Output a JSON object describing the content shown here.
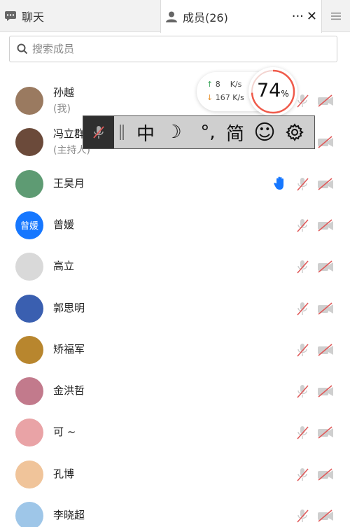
{
  "tabs": {
    "chat_label": "聊天",
    "members_label": "成员(26)",
    "more": "···",
    "close": "✕"
  },
  "search": {
    "placeholder": "搜索成员"
  },
  "network": {
    "up_value": "8",
    "up_unit": "K/s",
    "down_value": "167",
    "down_unit": "K/s",
    "cpu_percent": 74,
    "cpu_value": "74",
    "cpu_unit": "%"
  },
  "ime": {
    "chinese": "中",
    "moon": "☽",
    "punct": "°,",
    "simplified": "简",
    "emoji": "☺"
  },
  "members": [
    {
      "name": "孙越",
      "role": "(我)",
      "hand": false,
      "avatar_color": "#9a7a60"
    },
    {
      "name": "冯立群",
      "role": "(主持人)",
      "hand": false,
      "avatar_color": "#6b4a3a"
    },
    {
      "name": "王昊月",
      "role": "",
      "hand": true,
      "avatar_color": "#5e9b73"
    },
    {
      "name": "曾媛",
      "role": "",
      "hand": false,
      "avatar_color": "#1677ff",
      "avatar_text": "曾媛"
    },
    {
      "name": "高立",
      "role": "",
      "hand": false,
      "avatar_color": "#d9d9d9"
    },
    {
      "name": "郭思明",
      "role": "",
      "hand": false,
      "avatar_color": "#3a5fb0"
    },
    {
      "name": "矫福军",
      "role": "",
      "hand": false,
      "avatar_color": "#b8862e"
    },
    {
      "name": "金洪哲",
      "role": "",
      "hand": false,
      "avatar_color": "#c27a8c"
    },
    {
      "name": "可 ~",
      "role": "",
      "hand": false,
      "avatar_color": "#e9a3a6"
    },
    {
      "name": "孔博",
      "role": "",
      "hand": false,
      "avatar_color": "#f0c49a"
    },
    {
      "name": "李晓超",
      "role": "",
      "hand": false,
      "avatar_color": "#9ec6e8"
    }
  ],
  "colors": {
    "accent": "#1677ff",
    "muted_red": "#e05a5a",
    "gauge": "#ef5a4a"
  }
}
